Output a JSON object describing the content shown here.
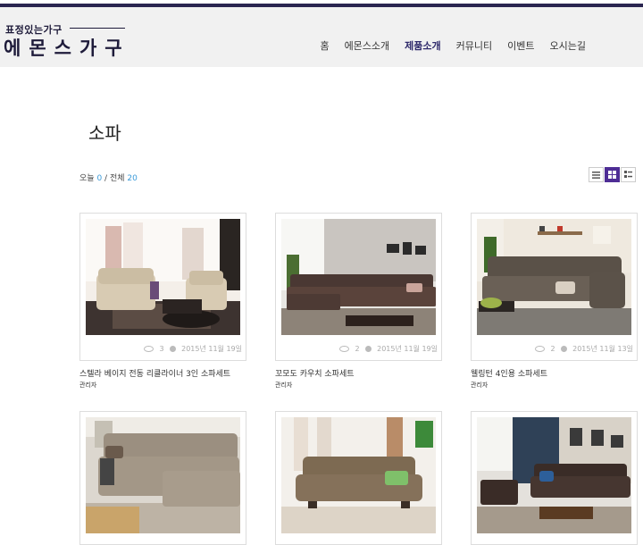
{
  "brand": {
    "tagline": "표정있는가구",
    "name": "에몬스가구"
  },
  "nav": [
    {
      "label": "홈"
    },
    {
      "label": "에몬스소개"
    },
    {
      "label": "제품소개",
      "active": true
    },
    {
      "label": "커뮤니티"
    },
    {
      "label": "이벤트"
    },
    {
      "label": "오시는길"
    }
  ],
  "page": {
    "title": "소파"
  },
  "counter": {
    "today_label": "오늘",
    "today": "0",
    "sep": "/",
    "total_label": "전체",
    "total": "20"
  },
  "view_modes": [
    {
      "icon": "list-view-icon"
    },
    {
      "icon": "grid-view-icon",
      "active": true
    },
    {
      "icon": "compact-view-icon"
    }
  ],
  "products": [
    {
      "title": "스텔라 베이지 전동 리클라이너 3인 소파세트",
      "author": "관리자",
      "views": "3",
      "date": "2015년 11월 19일",
      "image": "beige-recliner-sofa-photo"
    },
    {
      "title": "꼬모도 카우치 소파세트",
      "author": "관리자",
      "views": "2",
      "date": "2015년 11월 19일",
      "image": "brown-couch-sofa-photo"
    },
    {
      "title": "웰링턴 4인용 소파세트",
      "author": "관리자",
      "views": "2",
      "date": "2015년 11월 13일",
      "image": "chesterfield-sofa-photo"
    },
    {
      "title": "",
      "author": "",
      "views": "",
      "date": "",
      "image": "beige-corner-sofa-photo"
    },
    {
      "title": "",
      "author": "",
      "views": "",
      "date": "",
      "image": "tan-leather-sofa-photo"
    },
    {
      "title": "",
      "author": "",
      "views": "",
      "date": "",
      "image": "dark-brown-sofa-set-photo"
    }
  ],
  "colors": {
    "accent": "#4e2d95",
    "brand": "#1e1b3a",
    "link": "#3a9ad9"
  }
}
